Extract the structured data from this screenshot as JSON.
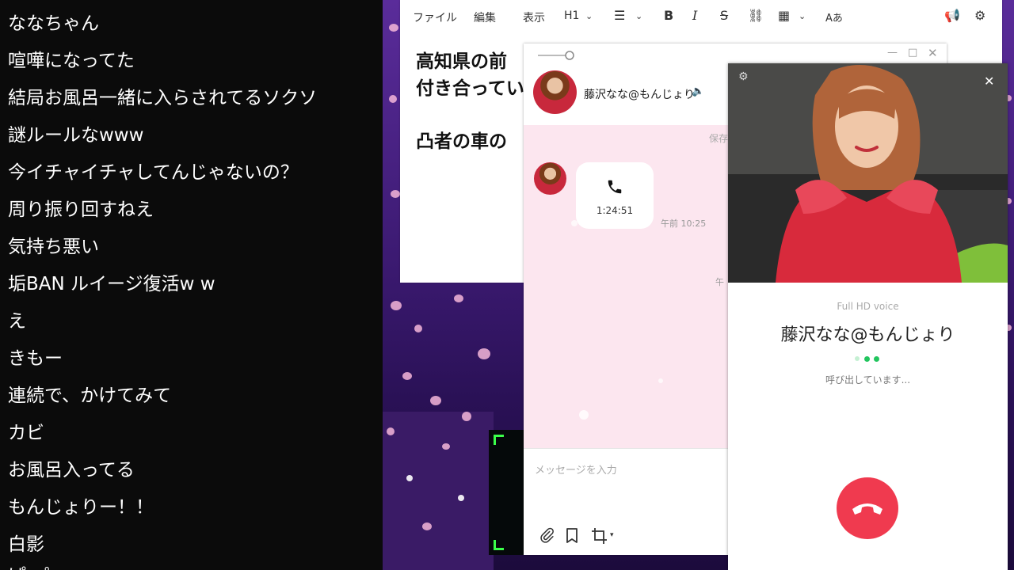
{
  "comments": [
    "ななちゃん",
    "喧嘩になってた",
    "結局お風呂一緒に入らされてるソクソ",
    "謎ルールなwww",
    "今イチャイチャしてんじゃないの？",
    "周り振り回すねえ",
    "気持ち悪い",
    "垢BAN ルイージ復活w w",
    "え",
    "きもー",
    "連続で、かけてみて",
    "カビ",
    "お風呂入ってる",
    "もんじょりー！！",
    "白影",
    "ぱー゜"
  ],
  "editor": {
    "menu": {
      "file": "ファイル",
      "edit": "編集",
      "view": "表示",
      "heading": "H1"
    },
    "body": [
      "高知県の前",
      "付き合ってい",
      "凸者の車の"
    ]
  },
  "chat": {
    "contact_name": "藤沢なな@もんじょり",
    "saved_label": "保存",
    "call_duration": "1:24:51",
    "timestamp": "午前 10:25",
    "partial_timestamp": "午",
    "input_placeholder": "メッセージを入力"
  },
  "call": {
    "quality": "Full HD voice",
    "name": "藤沢なな@もんじょり",
    "status": "呼び出しています..."
  },
  "colors": {
    "hangup": "#f03a4f",
    "chat_background": "#fce6ef",
    "status_dots": "#22c55e"
  },
  "icons": [
    "paperclip-icon",
    "bookmark-icon",
    "crop-icon",
    "phone-icon",
    "gear-icon",
    "close-icon",
    "speaker-icon",
    "announcement-icon"
  ]
}
